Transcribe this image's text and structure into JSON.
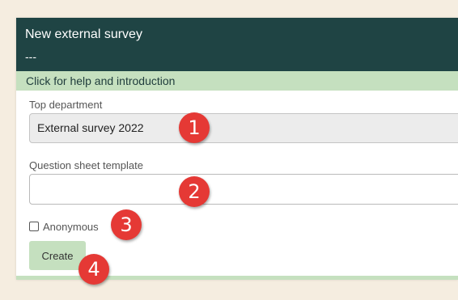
{
  "header": {
    "title": "New external survey",
    "subtitle": "---"
  },
  "help_bar": {
    "text": "Click for help and introduction"
  },
  "form": {
    "top_department": {
      "label": "Top department",
      "value": "External survey 2022"
    },
    "question_sheet_template": {
      "label": "Question sheet template",
      "value": ""
    },
    "anonymous": {
      "label": "Anonymous",
      "checked": false
    },
    "create_button": "Create"
  },
  "annotations": [
    "1",
    "2",
    "3",
    "4"
  ],
  "colors": {
    "page_background": "#f5ede0",
    "header_background": "#1f4444",
    "accent_green": "#c5e0bf",
    "marker_red": "#e53935"
  }
}
